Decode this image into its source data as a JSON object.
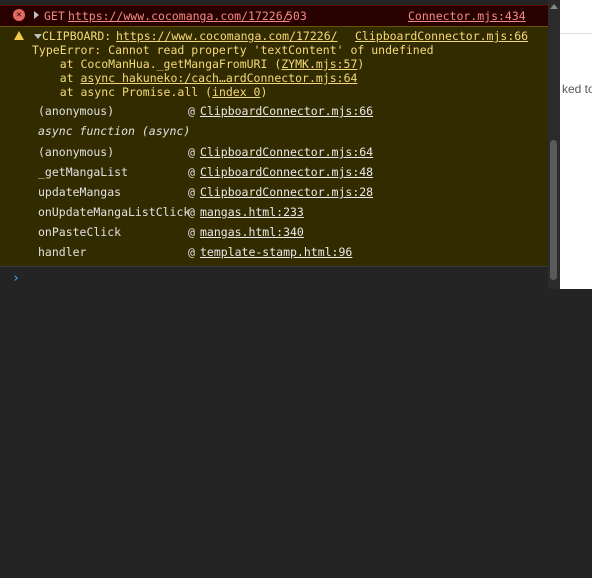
{
  "error_entry": {
    "method": "GET",
    "url": "https://www.cocomanga.com/17226/",
    "status": "503",
    "source": "Connector.mjs:434"
  },
  "warning_entry": {
    "prefix": "CLIPBOARD:",
    "url": "https://www.cocomanga.com/17226/",
    "source": "ClipboardConnector.mjs:66",
    "message": "TypeError: Cannot read property 'textContent' of undefined",
    "stack": [
      {
        "text": "    at CocoManHua._getMangaFromURI (",
        "link": "ZYMK.mjs:57",
        "end": ")"
      },
      {
        "text": "    at ",
        "link": "async hakuneko:/cach…ardConnector.mjs:64",
        "end": ""
      },
      {
        "text": "    at async Promise.all (",
        "link": "index 0",
        "end": ")"
      }
    ],
    "trace": [
      {
        "fn": "(anonymous)",
        "at": "@",
        "link": "ClipboardConnector.mjs:66"
      },
      {
        "fn": "async function (async)",
        "at": "",
        "link": ""
      },
      {
        "fn": "(anonymous)",
        "at": "@",
        "link": "ClipboardConnector.mjs:64"
      },
      {
        "fn": "_getMangaList",
        "at": "@",
        "link": "ClipboardConnector.mjs:48"
      },
      {
        "fn": "updateMangas",
        "at": "@",
        "link": "ClipboardConnector.mjs:28"
      },
      {
        "fn": "onUpdateMangaListClick",
        "at": "@",
        "link": "mangas.html:233"
      },
      {
        "fn": "onPasteClick",
        "at": "@",
        "link": "mangas.html:340"
      },
      {
        "fn": "handler",
        "at": "@",
        "link": "template-stamp.html:96"
      }
    ]
  },
  "prompt": {
    "symbol": "›"
  },
  "right_panel": {
    "text": "ked to"
  },
  "colors": {
    "error_bg": "#290000",
    "warning_bg": "#332b00",
    "link": "#e8e8e8"
  }
}
